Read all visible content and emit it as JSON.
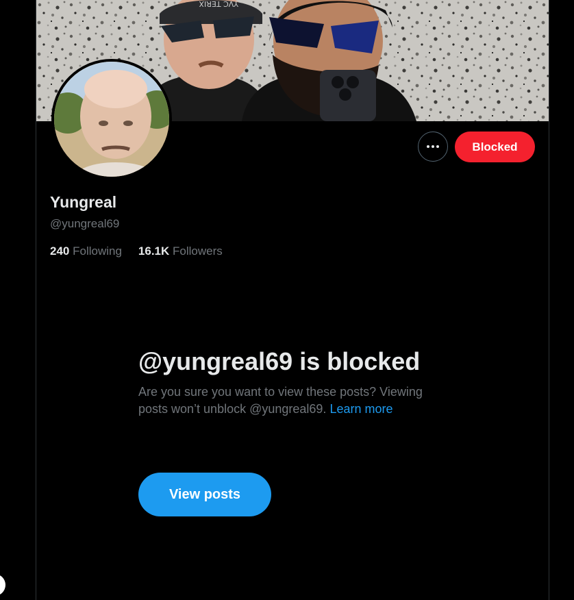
{
  "profile": {
    "display_name": "Yungreal",
    "handle": "@yungreal69",
    "following_count": "240",
    "following_label": "Following",
    "followers_count": "16.1K",
    "followers_label": "Followers"
  },
  "actions": {
    "more_icon": "more-horizontal-icon",
    "blocked_label": "Blocked"
  },
  "blocked_notice": {
    "title": "@yungreal69 is blocked",
    "description": "Are you sure you want to view these posts? Viewing posts won’t unblock @yungreal69.",
    "learn_more": "Learn more",
    "view_posts_label": "View posts"
  },
  "banner": {
    "cap_text": "YVC TERIX"
  },
  "colors": {
    "background": "#000000",
    "blocked_red": "#f4212e",
    "accent_blue": "#1d9bf0",
    "muted_text": "#71767b",
    "primary_text": "#e7e9ea"
  }
}
